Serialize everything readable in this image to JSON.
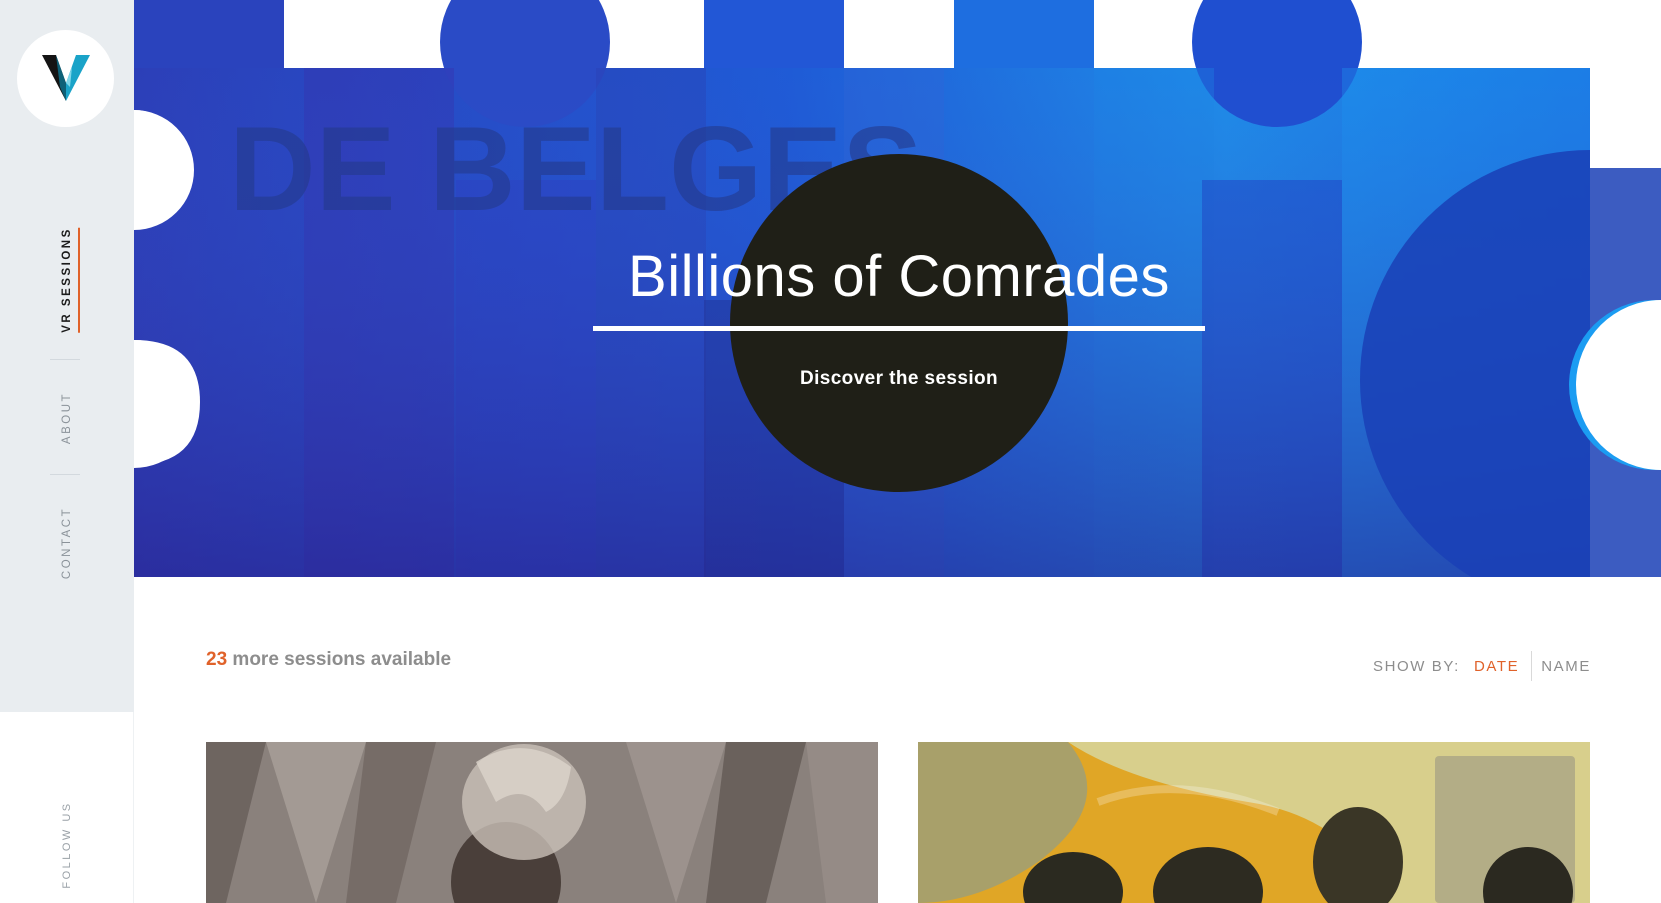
{
  "sidebar": {
    "logo_icon": "v-logo-icon",
    "nav": [
      {
        "label": "VR SESSIONS",
        "active": true
      },
      {
        "label": "ABOUT",
        "active": false
      },
      {
        "label": "CONTACT",
        "active": false
      }
    ],
    "follow_label": "FOLLOW US"
  },
  "hero": {
    "title": "Billions of Comrades",
    "cta": "Discover the session",
    "background_text": [
      "DE BELGES"
    ]
  },
  "sessions": {
    "count": "23",
    "count_suffix": " more sessions available",
    "show_by_label": "SHOW BY:",
    "sort_options": [
      {
        "label": "DATE",
        "active": true
      },
      {
        "label": "NAME",
        "active": false
      }
    ]
  },
  "colors": {
    "accent": "#e0622a",
    "hero_blue": "#1e64e0",
    "sidebar_bg": "#e9edf0",
    "circle": "#1f1f17"
  }
}
